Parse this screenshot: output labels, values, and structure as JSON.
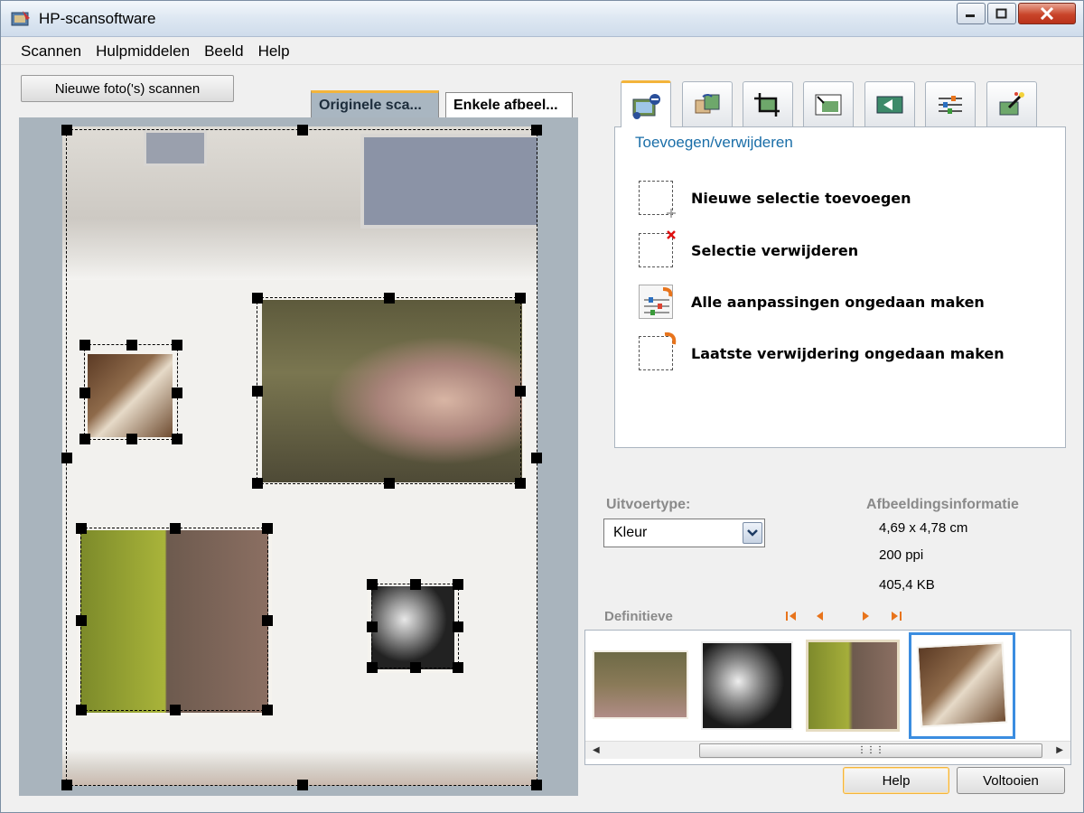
{
  "window": {
    "title": "HP-scansoftware"
  },
  "menu": [
    "Scannen",
    "Hulpmiddelen",
    "Beeld",
    "Help"
  ],
  "left": {
    "scan_button": "Nieuwe foto('s) scannen",
    "tabs": [
      "Originele sca...",
      "Enkele afbeel..."
    ]
  },
  "panel": {
    "title": "Toevoegen/verwijderen",
    "tab_icons": [
      "add-remove-icon",
      "rotate-icon",
      "crop-icon",
      "resize-icon",
      "color-icon",
      "adjust-icon",
      "magic-wand-icon"
    ],
    "actions": [
      "Nieuwe selectie toevoegen",
      "Selectie verwijderen",
      "Alle aanpassingen ongedaan maken",
      "Laatste verwijdering ongedaan maken"
    ]
  },
  "output": {
    "label": "Uitvoertype:",
    "value": "Kleur"
  },
  "image_info": {
    "label": "Afbeeldingsinformatie",
    "size": "4,69 x 4,78 cm",
    "resolution": "200 ppi",
    "filesize": "405,4 KB"
  },
  "final": {
    "label": "Definitieve"
  },
  "buttons": {
    "help": "Help",
    "finish": "Voltooien"
  },
  "colors": {
    "accent": "#f3b43b",
    "title_blue": "#1a6ea8",
    "selection": "#3b8de0",
    "nav_orange": "#e8741c"
  }
}
